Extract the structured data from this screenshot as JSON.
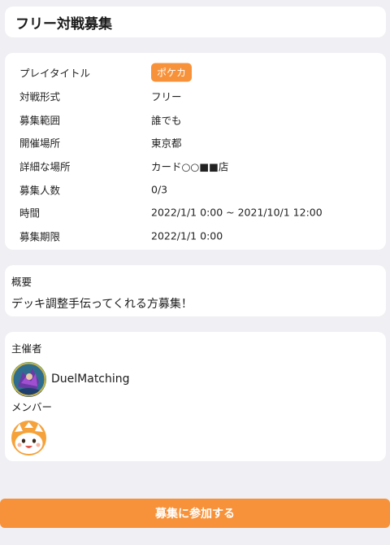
{
  "header": {
    "title": "フリー対戦募集"
  },
  "details": [
    {
      "label": "プレイタイトル",
      "value": "ポケカ",
      "is_tag": true
    },
    {
      "label": "対戦形式",
      "value": "フリー"
    },
    {
      "label": "募集範囲",
      "value": "誰でも"
    },
    {
      "label": "開催場所",
      "value": "東京都"
    },
    {
      "label": "詳細な場所",
      "value": "カード○○■■店"
    },
    {
      "label": "募集人数",
      "value": "0/3"
    },
    {
      "label": "時間",
      "value": "2022/1/1 0:00 ~ 2021/10/1 12:00"
    },
    {
      "label": "募集期限",
      "value": "2022/1/1 0:00"
    }
  ],
  "summary": {
    "heading": "概要",
    "text": "デッキ調整手伝ってくれる方募集！"
  },
  "people": {
    "host_heading": "主催者",
    "host_name": "DuelMatching",
    "member_heading": "メンバー"
  },
  "actions": {
    "join_label": "募集に参加する"
  },
  "colors": {
    "accent": "#f7923a",
    "background": "#efeff4",
    "card": "#ffffff"
  }
}
